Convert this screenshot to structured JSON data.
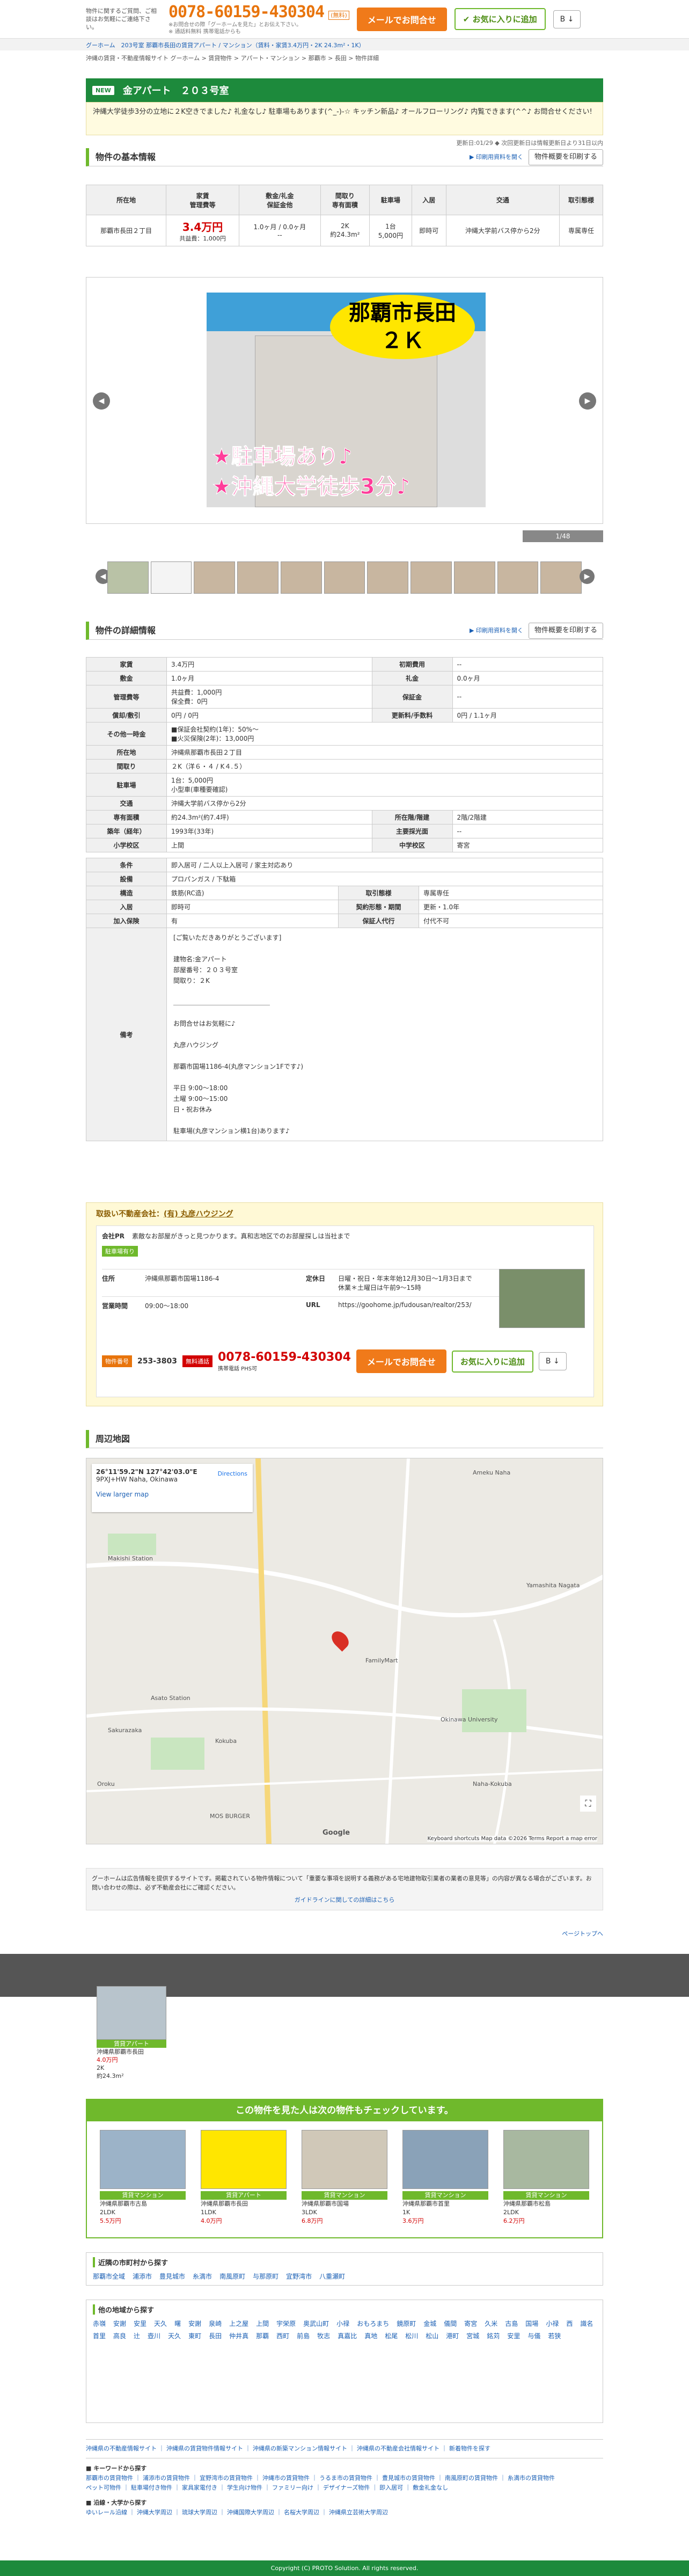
{
  "top": {
    "note": "物件に関するご質問、ご相談はお気軽にご連絡下さい。",
    "phone": "0078-60159-430304",
    "free": "(無料)",
    "small1": "※お問合せの際「グーホームを見た」とお伝え下さい。",
    "small2": "※ 通話料無料 携帯電話からも",
    "contact_btn": "メールでお問合せ",
    "fav_btn": "お気に入りに追加",
    "share_btn": "B ↓"
  },
  "breadcrumb1": "グーホーム　203号室 那覇市長田の賃貸アパート / マンション（賃料・家賃3.4万円・2K 24.3m²・1K）",
  "breadcrumb2": "沖縄の賃貸・不動産情報サイト グーホーム > 賃貸物件 > アパート・マンション > 那覇市 > 長田 > 物件詳細",
  "title": {
    "new": "NEW",
    "name": "金アパート　２０３号室"
  },
  "catch": "沖縄大学徒歩3分の立地に２K空きでました♪ 礼金なし♪ 駐車場もあります(^_-)-☆ キッチン新品♪ オールフローリング♪ 内覧できます(^^♪ お問合せください!",
  "updated": "更新日:01/29 ◆ 次回更新日は情報更新日より31日以内",
  "basic": {
    "heading": "物件の基本情報",
    "pdf": "▶ 印刷用資料を開く",
    "print": "物件概要を印刷する",
    "headers": [
      "所在地",
      "家賃\n管理費等",
      "敷金/礼金\n保証金他",
      "間取り\n専有面積",
      "駐車場",
      "入居",
      "交通",
      "取引態様"
    ],
    "cells": [
      "那覇市長田２丁目",
      "3.4万円",
      "共益費：1,000円",
      "1.0ヶ月 / 0.0ヶ月\n--",
      "2K\n約24.3m²",
      "1台\n5,000円",
      "即時可",
      "沖縄大学前バス停から2分",
      "専属専任"
    ]
  },
  "gallery": {
    "counter": "1/48"
  },
  "detail": {
    "heading": "物件の詳細情報",
    "pdf": "▶ 印刷用資料を開く",
    "print": "物件概要を印刷する",
    "rows": [
      [
        "家賃",
        "3.4万円",
        "初期費用",
        "--"
      ],
      [
        "敷金",
        "1.0ヶ月",
        "礼金",
        "0.0ヶ月"
      ],
      [
        "管理費等",
        "共益費：1,000円\n保全費：0円",
        "保証金",
        "--"
      ],
      [
        "償却/敷引",
        "0円 / 0円",
        "更新料/手数料",
        "0円 / 1.1ヶ月"
      ]
    ],
    "other_label": "その他一時金",
    "other_val": "■保証会社契約(1年)：50%〜\n■火災保険(2年)：13,000円",
    "full": [
      [
        "所在地",
        "沖縄県那覇市長田２丁目"
      ],
      [
        "間取り",
        "２K（洋６・４ / K４.５）"
      ],
      [
        "駐車場",
        "1台：5,000円\n小型車(車種要確認)"
      ],
      [
        "交通",
        "沖縄大学前バス停から2分"
      ]
    ],
    "rows2": [
      [
        "専有面積",
        "約24.3m²(約7.4坪)",
        "所在階/階建",
        "2階/2階建"
      ],
      [
        "築年（経年）",
        "1993年(33年)",
        "主要採光面",
        "--"
      ],
      [
        "小学校区",
        "上間",
        "中学校区",
        "寄宮"
      ]
    ],
    "rows3": [
      [
        "条件",
        "即入居可 / 二人以上入居可 / 家主対応あり"
      ],
      [
        "設備",
        "プロパンガス / 下駄箱"
      ]
    ],
    "struct": [
      "構造",
      "鉄筋(RC造)",
      "取引態様",
      "専属専任"
    ],
    "move": [
      "入居",
      "即時可",
      "契約形態・期間",
      "更新・1.0年"
    ],
    "insurance": [
      "加入保険",
      "有",
      "保証人代行",
      "付代不可"
    ],
    "remarks_label": "備考",
    "remarks": "[ご覧いただきありがとうございます]\n\n建物名:金アパート\n部屋番号：２０３号室\n間取り：２K\n\n＿＿＿＿＿＿＿＿＿＿＿＿＿＿＿\n\nお問合せはお気軽に♪\n\n丸彦ハウジング\n\n那覇市国場1186-4(丸彦マンション1Fです♪)\n\n平日 9:00〜18:00\n土曜 9:00〜15:00\n日・祝お休み\n\n駐車場(丸彦マンション横1台)あります♪"
  },
  "agent": {
    "title": "取扱い不動産会社：",
    "name": "(有) 丸彦ハウジング",
    "pr_label": "会社PR",
    "pr": "素敵なお部屋がきっと見つかります。真和志地区でのお部屋探しは当社まで",
    "badge": "駐車場有り",
    "addr_label": "住所",
    "addr": "沖縄県那覇市国場1186-4",
    "hours_label": "営業時間",
    "hours": "09:00〜18:00",
    "holiday_label": "定休日",
    "holiday": "日曜・祝日・年末年始12月30日〜1月3日まで休業＊土曜日は午前9〜15時",
    "url_label": "URL",
    "url": "https://goohome.jp/fudousan/realtor/253/",
    "num_label": "物件番号",
    "num": "253-3803",
    "free_label": "無料通話",
    "phone": "0078-60159-430304",
    "phone_sub": "携帯電話 PHS可",
    "contact": "メールでお問合せ",
    "fav": "お気に入りに追加",
    "share": "B ↓"
  },
  "map": {
    "heading": "周辺地図",
    "coords": "26°11'59.2\"N 127°42'03.0\"E",
    "area": "9PXJ+HW Naha, Okinawa",
    "directions": "Directions",
    "larger": "View larger map",
    "labels": [
      "Ameku Naha",
      "Makishi Station",
      "Asato Station",
      "Okinawa University",
      "Yamashita Nagata",
      "FamilyMart",
      "Naha-Kokuba",
      "Kokuba",
      "Sakurazaka",
      "MOS BURGER",
      "Oroku",
      "Google"
    ],
    "attrib": "Keyboard shortcuts  Map data ©2026 Terms  Report a map error"
  },
  "disclaimer": "グーホームは広告情報を提供するサイトです。掲載されている物件情報について「重要な事項を説明する義務がある宅地建物取引業者の業者の意見等」の内容が異なる場合がございます。お問い合わせの際は、必ず不動産会社にご確認ください。",
  "disclaimer_link": "ガイドラインに関しての詳細はこちら",
  "page_top": "ページトップへ",
  "reco": {
    "heading": "この物件を見た人は次の物件もチェックしています。",
    "items": [
      {
        "tag": "賃貸マンション",
        "line1": "沖縄県那覇市古島",
        "line2": "2LDK",
        "line3": "5.5万円"
      },
      {
        "tag": "賃貸アパート",
        "line1": "沖縄県那覇市長田",
        "line2": "1LDK",
        "line3": "4.0万円"
      },
      {
        "tag": "賃貸マンション",
        "line1": "沖縄県那覇市国場",
        "line2": "3LDK",
        "line3": "6.8万円"
      },
      {
        "tag": "賃貸マンション",
        "line1": "沖縄県那覇市首里",
        "line2": "1K",
        "line3": "3.6万円"
      },
      {
        "tag": "賃貸マンション",
        "line1": "沖縄県那覇市松島",
        "line2": "2LDK",
        "line3": "6.2万円"
      }
    ]
  },
  "near": {
    "heading": "近隣の市町村から探す",
    "links": [
      "那覇市全域",
      "浦添市",
      "豊見城市",
      "糸満市",
      "南風原町",
      "与那原町",
      "宜野湾市",
      "八重瀬町"
    ]
  },
  "towns": {
    "heading": "他の地域から探す",
    "links": [
      "赤嶺",
      "安謝",
      "安里",
      "天久",
      "曙",
      "安謝",
      "泉崎",
      "上之屋",
      "上間",
      "宇栄原",
      "奥武山町",
      "小禄",
      "おもろまち",
      "鏡原町",
      "金城",
      "儀間",
      "寄宮",
      "久米",
      "古島",
      "国場",
      "小禄",
      "西",
      "識名",
      "首里",
      "高良",
      "辻",
      "壺川",
      "天久",
      "東町",
      "長田",
      "仲井真",
      "那覇",
      "西町",
      "前島",
      "牧志",
      "真嘉比",
      "真地",
      "松尾",
      "松川",
      "松山",
      "港町",
      "宮城",
      "銘苅",
      "安里",
      "与儀",
      "若狭"
    ]
  },
  "footnav": {
    "links1": "沖縄県の不動産情報サイト ｜ 沖縄県の賃貸物件情報サイト ｜ 沖縄県の新築マンション情報サイト ｜ 沖縄県の不動産会社情報サイト ｜ 新着物件を探す",
    "sub1": "■ キーワードから探す",
    "links2": "那覇市の賃貸物件 ｜ 浦添市の賃貸物件 ｜ 宜野湾市の賃貸物件 ｜ 沖縄市の賃貸物件 ｜ うるま市の賃貸物件 ｜ 豊見城市の賃貸物件 ｜ 南風原町の賃貸物件 ｜ 糸満市の賃貸物件",
    "links3": "ペット可物件 ｜ 駐車場付き物件 ｜ 家具家電付き ｜ 学生向け物件 ｜ ファミリー向け ｜ デザイナーズ物件 ｜ 即入居可 ｜ 敷金礼金なし",
    "sub2": "■ 沿線・大学から探す",
    "links4": "ゆいレール沿線 ｜ 沖縄大学周辺 ｜ 琉球大学周辺 ｜ 沖縄国際大学周辺 ｜ 名桜大学周辺 ｜ 沖縄県立芸術大学周辺"
  },
  "copyright": "Copyright (C) PROTO Solution. All rights reserved."
}
